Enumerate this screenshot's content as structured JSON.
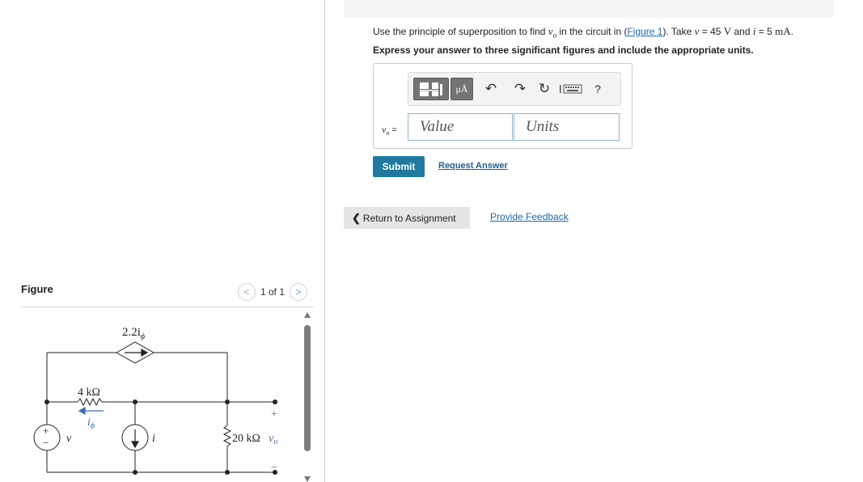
{
  "question": {
    "prefix": "Use the principle of superposition to find ",
    "var_v": "v",
    "var_v_sub": "o",
    "mid": " in the circuit in (",
    "figure_link": "Figure 1",
    "after_link": "). Take ",
    "v_var": "v",
    "v_eq": " = 45 ",
    "v_unit": "V",
    "and": " and ",
    "i_var": "i",
    "i_eq": " = 5 ",
    "i_unit": "mA",
    "end": "."
  },
  "instruction": "Express your answer to three significant figures and include the appropriate units.",
  "toolbar": {
    "units_label": "μÅ",
    "undo_icon": "undo-icon",
    "redo_icon": "redo-icon",
    "reset_icon": "reset-icon",
    "keyboard_icon": "keyboard-icon",
    "help_label": "?"
  },
  "answer": {
    "label_var": "v",
    "label_sub": "o",
    "label_eq": " =",
    "value_placeholder": "Value",
    "units_placeholder": "Units"
  },
  "actions": {
    "submit": "Submit",
    "request_answer": "Request Answer",
    "return": "Return to Assignment",
    "feedback": "Provide Feedback"
  },
  "figure": {
    "header": "Figure",
    "pager": "1 of 1",
    "prev_icon": "chevron-left-icon",
    "next_icon": "chevron-right-icon",
    "labels": {
      "dependent_source": "2.2i",
      "dependent_source_sub": "ϕ",
      "r1": "4 kΩ",
      "current_label": "i",
      "current_label_sub": "ϕ",
      "voltage_source": "v",
      "current_source": "i",
      "r2": "20 kΩ",
      "vo": "v",
      "vo_sub": "o",
      "plus": "+",
      "minus": "−"
    }
  },
  "colors": {
    "submit_bg": "#1f7a9e",
    "link": "#1a6aa8",
    "input_border": "#8fb4cf"
  }
}
